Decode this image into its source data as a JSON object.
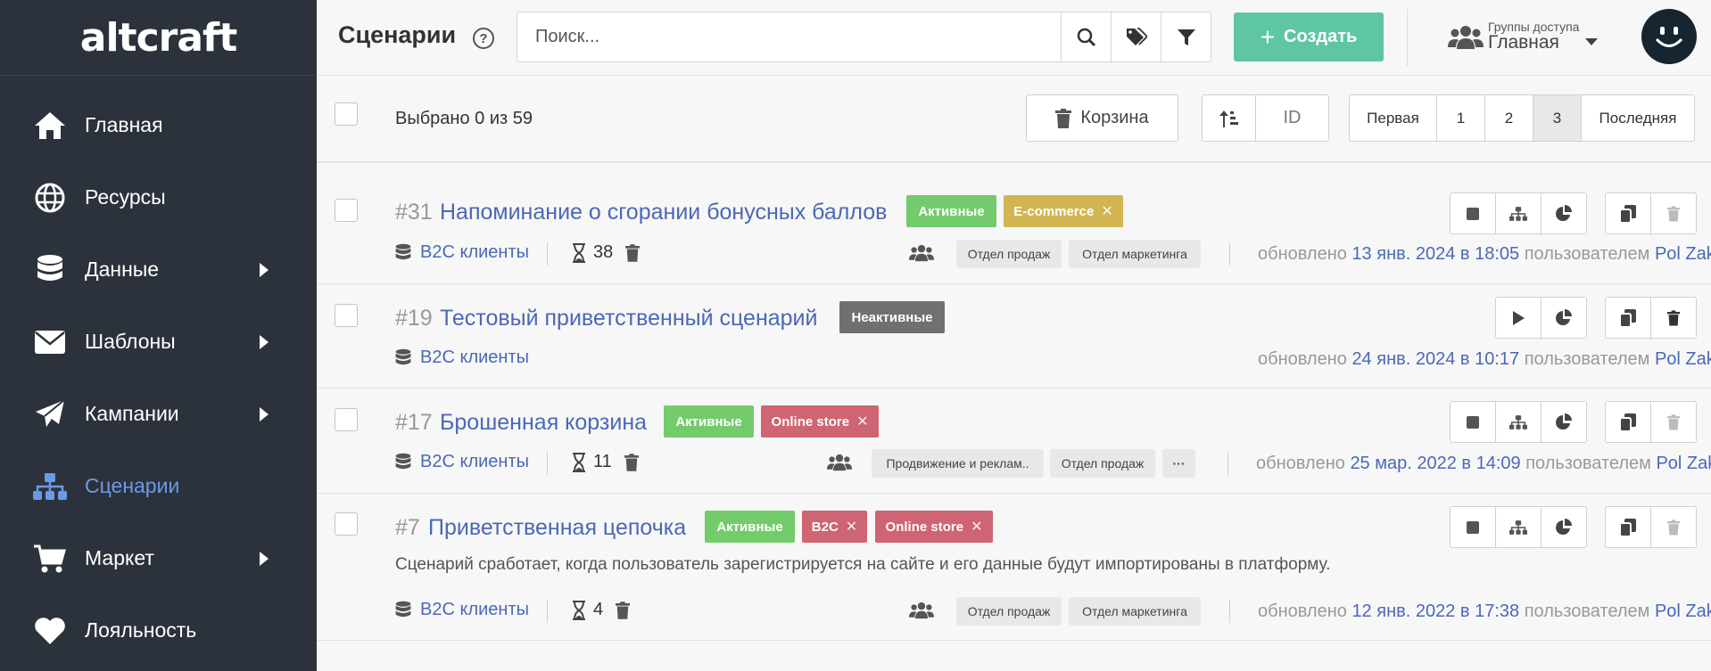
{
  "app": {
    "logo": "altcraft"
  },
  "sidebar": {
    "items": [
      {
        "label": "Главная"
      },
      {
        "label": "Ресурсы"
      },
      {
        "label": "Данные"
      },
      {
        "label": "Шаблоны"
      },
      {
        "label": "Кампании"
      },
      {
        "label": "Сценарии"
      },
      {
        "label": "Маркет"
      },
      {
        "label": "Лояльность"
      }
    ],
    "active_color": "#6b9ae8"
  },
  "header": {
    "title": "Сценарии",
    "help": "?",
    "search_placeholder": "Поиск...",
    "create_label": "Создать",
    "group_label": "Группы доступа",
    "group_value": "Главная"
  },
  "toolbar": {
    "selected": "Выбрано 0 из 59",
    "trash_label": "Корзина",
    "sort_label": "ID",
    "pages": [
      "Первая",
      "1",
      "2",
      "3",
      "Последняя"
    ],
    "current_page": "3"
  },
  "scenarios": [
    {
      "id": "#31",
      "title": "Напоминание о сгорании бонусных баллов",
      "tags": [
        "Активные",
        "E-commerce"
      ],
      "database": "B2C клиенты",
      "count": "38",
      "departments": [
        "Отдел продаж",
        "Отдел маркетинга"
      ],
      "updated_prefix": "обновлено",
      "updated_date": "13 янв. 2024 в 18:05",
      "updated_by_label": "пользователем",
      "user": "Pol Zak"
    },
    {
      "id": "#19",
      "title": "Тестовый приветственный сценарий",
      "tags": [
        "Неактивные"
      ],
      "database": "B2C клиенты",
      "updated_prefix": "обновлено",
      "updated_date": "24 янв. 2024 в 10:17",
      "updated_by_label": "пользователем",
      "user": "Pol Zak"
    },
    {
      "id": "#17",
      "title": "Брошенная корзина",
      "tags": [
        "Активные",
        "Online store"
      ],
      "database": "B2C клиенты",
      "count": "11",
      "departments": [
        "Продвижение и реклам..",
        "Отдел продаж"
      ],
      "more": "···",
      "updated_prefix": "обновлено",
      "updated_date": "25 мар. 2022 в 14:09",
      "updated_by_label": "пользователем",
      "user": "Pol Zak"
    },
    {
      "id": "#7",
      "title": "Приветственная цепочка",
      "tags": [
        "Активные",
        "B2C",
        "Online store"
      ],
      "description": "Сценарий сработает, когда пользователь зарегистрируется на сайте и его данные будут импортированы в платформу.",
      "database": "B2C клиенты",
      "count": "4",
      "departments": [
        "Отдел продаж",
        "Отдел маркетинга"
      ],
      "updated_prefix": "обновлено",
      "updated_date": "12 янв. 2022 в 17:38",
      "updated_by_label": "пользователем",
      "user": "Pol Zak"
    }
  ],
  "colors": {
    "sidebar_bg": "#2c323b",
    "create_btn": "#5fc6a4",
    "link": "#4b68b8",
    "tag_active": "#74cb6c",
    "tag_ecommerce": "#d2b553",
    "tag_inactive": "#707070",
    "tag_store": "#cf6472"
  }
}
